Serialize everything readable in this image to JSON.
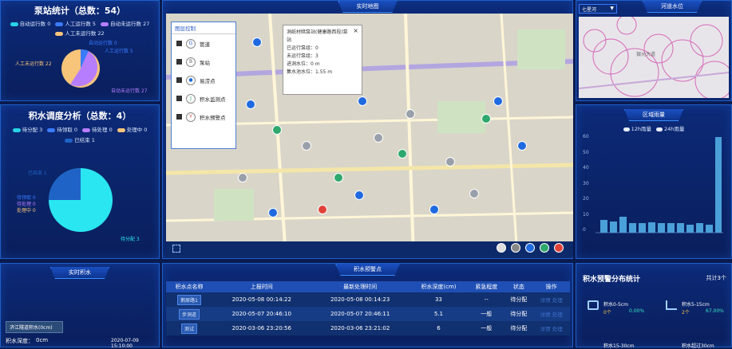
{
  "pump": {
    "title": "泵站统计（总数：54）",
    "legend": [
      {
        "label": "自动运行数 0",
        "color": "#29d3e6"
      },
      {
        "label": "人工运行数 5",
        "color": "#3a7bff"
      },
      {
        "label": "自动未运行数 27",
        "color": "#b77dff"
      },
      {
        "label": "人工未运行数 22",
        "color": "#f7c47a"
      }
    ],
    "labels": {
      "auto_run": "自动运行数 0",
      "manual_run": "人工运行数 5",
      "manual_not": "人工未运行数 22",
      "auto_not": "自动未运行数 27"
    }
  },
  "dispatch": {
    "title": "积水调度分析（总数：4）",
    "legend": [
      {
        "label": "待分配 3",
        "color": "#29d3e6"
      },
      {
        "label": "待领取 0",
        "color": "#3a7bff"
      },
      {
        "label": "待处理 0",
        "color": "#b77dff"
      },
      {
        "label": "处理中 0",
        "color": "#f7c47a"
      }
    ],
    "legend2": {
      "label": "已结束 1",
      "color": "#1f63c6"
    },
    "labels": {
      "ended": "已结束 1",
      "pending": "待领取 0",
      "todo": "待处理 0",
      "processing": "处理中 0",
      "assign": "待分配 3"
    }
  },
  "realtime": {
    "title": "实时积水",
    "button": "济江隧道积水(0cm)",
    "depth_label": "积水深度：",
    "depth": "0cm",
    "time": "2020-07-09 15:10:00"
  },
  "map": {
    "title": "实时地图",
    "layer_title": "图层控制",
    "layers": [
      {
        "label": "管道",
        "icon": "G"
      },
      {
        "label": "泵站",
        "icon": "B"
      },
      {
        "label": "易涝点",
        "icon": "●"
      },
      {
        "label": "积水监测点",
        "icon": "J"
      },
      {
        "label": "积水预警点",
        "icon": "Y"
      }
    ],
    "popup": {
      "title": "洞纸材暗泵站(健康路西段)泵站",
      "close": "×",
      "lines": [
        "已运行泵组：0",
        "未运行泵组：3",
        "进洞水位：0 m",
        "集水池水位：1.55 m"
      ]
    }
  },
  "river": {
    "title": "河道水位",
    "select": "七星河",
    "select_arrow": "▼",
    "place": "银元大道"
  },
  "rain": {
    "title": "区域雨量",
    "legend": [
      "12h雨量",
      "24h雨量"
    ],
    "ylabels": [
      "60",
      "50",
      "40",
      "30",
      "20",
      "10",
      "0"
    ]
  },
  "table": {
    "title": "积水预警点",
    "headers": [
      "积水点名称",
      "上报时间",
      "最新处理时间",
      "积水深度(cm)",
      "紧急程度",
      "状态",
      "操作"
    ],
    "rows": [
      {
        "name": "鹅原路1",
        "report": "2020-05-08 00:14:22",
        "latest": "2020-05-08 00:14:23",
        "depth": "33",
        "level": "--",
        "status": "待分配",
        "ops": "详情 处理"
      },
      {
        "name": "步洞道",
        "report": "2020-05-07 20:46:10",
        "latest": "2020-05-07 20:46:11",
        "depth": "5.1",
        "level": "一般",
        "status": "待分配",
        "ops": "详情 处理"
      },
      {
        "name": "测试",
        "report": "2020-03-06 23:20:56",
        "latest": "2020-03-06 23:21:02",
        "depth": "6",
        "level": "一般",
        "status": "待分配",
        "ops": "详情 处理"
      }
    ]
  },
  "warn": {
    "title": "积水预警分布统计",
    "total": "共计3个",
    "items": [
      {
        "range": "积水0-5cm",
        "count": "0个",
        "pct": "0.00%"
      },
      {
        "range": "积水5-15cm",
        "count": "2个",
        "pct": "67.00%"
      },
      {
        "range": "积水15-30cm",
        "count": "",
        "pct": ""
      },
      {
        "range": "积水超过30cm",
        "count": "",
        "pct": ""
      }
    ]
  }
}
